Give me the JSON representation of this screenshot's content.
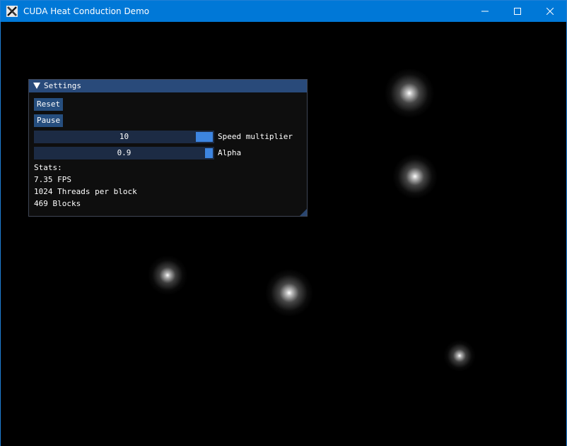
{
  "window": {
    "title": "CUDA Heat Conduction Demo",
    "app_icon": "x-logo-icon",
    "controls": [
      "minimize-icon",
      "maximize-icon",
      "close-icon"
    ]
  },
  "settings_panel": {
    "title": "Settings",
    "reset_label": "Reset",
    "pause_label": "Pause",
    "speed_slider": {
      "value": "10",
      "label": "Speed multiplier",
      "fraction": 0.9
    },
    "alpha_slider": {
      "value": "0.9",
      "label": "Alpha",
      "fraction": 0.9
    },
    "stats_heading": "Stats:",
    "fps": "7.35 FPS",
    "threads": "1024 Threads per block",
    "blocks": "469 Blocks"
  },
  "colors": {
    "titlebar": "#0078d7",
    "panel_header": "#294a7a",
    "button": "#264e7e",
    "slider_bg": "#1c2b44",
    "slider_grab": "#3d85e0",
    "canvas": "#000000"
  }
}
